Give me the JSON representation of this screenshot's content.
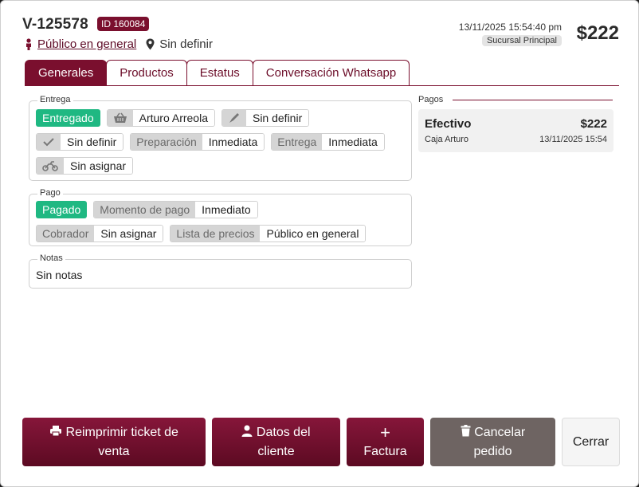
{
  "header": {
    "sale_id": "V-125578",
    "id_badge": "ID 160084",
    "client": "Público en general",
    "location": "Sin definir",
    "datetime": "13/11/2025 15:54:40 pm",
    "branch": "Sucursal Principal",
    "total": "$222"
  },
  "tabs": [
    "Generales",
    "Productos",
    "Estatus",
    "Conversación Whatsapp"
  ],
  "entrega": {
    "legend": "Entrega",
    "status": "Entregado",
    "courier_name": "Arturo Arreola",
    "tool_value": "Sin definir",
    "check_value": "Sin definir",
    "preparacion_label": "Preparación",
    "preparacion_value": "Inmediata",
    "entrega_label": "Entrega",
    "entrega_value": "Inmediata",
    "moto_value": "Sin asignar"
  },
  "pago": {
    "legend": "Pago",
    "status": "Pagado",
    "momento_label": "Momento de pago",
    "momento_value": "Inmediato",
    "cobrador_label": "Cobrador",
    "cobrador_value": "Sin asignar",
    "lista_label": "Lista de precios",
    "lista_value": "Público en general"
  },
  "notas": {
    "legend": "Notas",
    "text": "Sin notas"
  },
  "pagos": {
    "label": "Pagos",
    "items": [
      {
        "method": "Efectivo",
        "amount": "$222",
        "box": "Caja Arturo",
        "date": "13/11/2025 15:54"
      }
    ]
  },
  "footer": {
    "reprint": "Reimprimir ticket de venta",
    "client_data": "Datos del cliente",
    "invoice_plus": "+",
    "invoice": "Factura",
    "cancel": "Cancelar pedido",
    "close": "Cerrar"
  },
  "colors": {
    "brand": "#7a0f2e",
    "success": "#1fb882",
    "muted_button": "#6e6462"
  }
}
